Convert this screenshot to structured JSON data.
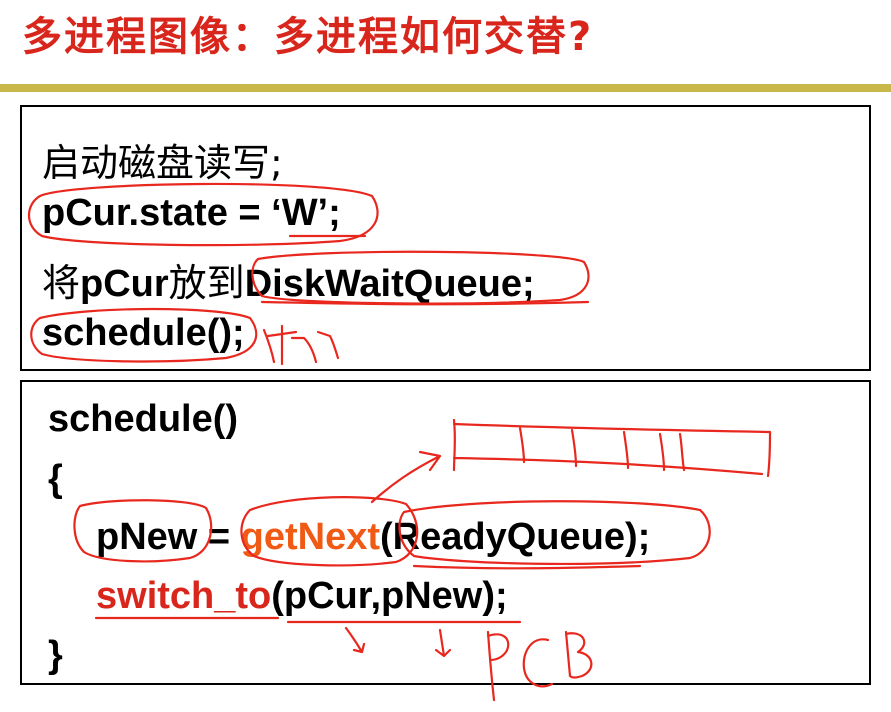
{
  "slide": {
    "title": "多进程图像：多进程如何交替?"
  },
  "box1": {
    "line1": "启动磁盘读写;",
    "line2": "pCur.state = ‘W’;",
    "line3_prefix": "将",
    "line3_var": "pCur",
    "line3_mid": "放到",
    "line3_queue": "DiskWaitQueue;",
    "line4": "schedule();"
  },
  "box2": {
    "header": "schedule()",
    "open_brace": "{",
    "stmt1_lhs": "pNew = ",
    "stmt1_func": "getNext",
    "stmt1_args": "(ReadyQueue);",
    "stmt2_func": "switch_to",
    "stmt2_args": "(pCur,pNew);",
    "close_brace": "}"
  },
  "annotations": {
    "handwritten_switch": "切",
    "handwritten_pcb": "PCB"
  },
  "colors": {
    "title": "#d9261c",
    "rule": "#c8b94a",
    "orange_func": "#f05a14",
    "red_func": "#d9261c",
    "ink": "#e8281e"
  }
}
